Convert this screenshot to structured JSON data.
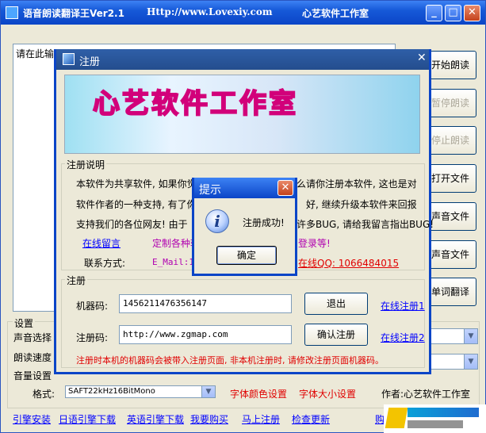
{
  "main": {
    "title_app": "语音朗读翻译王Ver2.1",
    "title_url": "Http://www.Lovexiy.com",
    "title_studio": "心艺软件工作室",
    "textarea_text": "请在此输入",
    "side_buttons": [
      "开始朗读",
      "暂停朗读",
      "停止朗读",
      "打开文件",
      "保存声音文件",
      "转换声音文件",
      "单词翻译"
    ],
    "settings": {
      "group_label": "设置",
      "voice_label": "声音选择",
      "speed_label": "朗读速度",
      "volume_label": "音量设置",
      "format_label": "格式:",
      "format_value": "SAFT22kHz16BitMono",
      "font_color_link": "字体颜色设置",
      "font_size_link": "字体大小设置",
      "author": "作者:心艺软件工作室"
    },
    "bottom_links": [
      "引擎安装",
      "日语引擎下载",
      "英语引擎下载",
      "我要购买",
      "马上注册",
      "检查更新"
    ],
    "bottom_right": "购买"
  },
  "register": {
    "title": "注册",
    "banner_text": "心艺软件工作室",
    "desc_group": "注册说明",
    "desc_line1_a": "本软件为共享软件, 如果你觉",
    "desc_line1_b": "么请你注册本软件, 这也是对",
    "desc_line2_a": "软件作者的一种支持, 有了你",
    "desc_line2_b": "好, 继续升级本软件来回报",
    "desc_line3_a": "支持我们的各位网友!  由于",
    "desc_line3_b": "许多BUG, 请给我留言指出BUG!",
    "online_msg_link": "在线留言",
    "custom_text": "定制各种软",
    "custom_text_b": "登录等!",
    "contact_label": "联系方式:",
    "email_text": "E_Mail:10",
    "qq_text": "在线QQ: 1066484015",
    "reg_group": "注册",
    "machine_label": "机器码:",
    "machine_value": "1456211476356147",
    "exit_button": "退出",
    "online_reg1": "在线注册1",
    "code_label": "注册码:",
    "code_value": "http://www.zgmap.com",
    "confirm_button": "确认注册",
    "online_reg2": "在线注册2",
    "warning": "注册时本机的机器码会被带入注册页面, 非本机注册时, 请修改注册页面机器码。"
  },
  "hint": {
    "title": "提示",
    "message": "注册成功!",
    "ok_button": "确定"
  }
}
